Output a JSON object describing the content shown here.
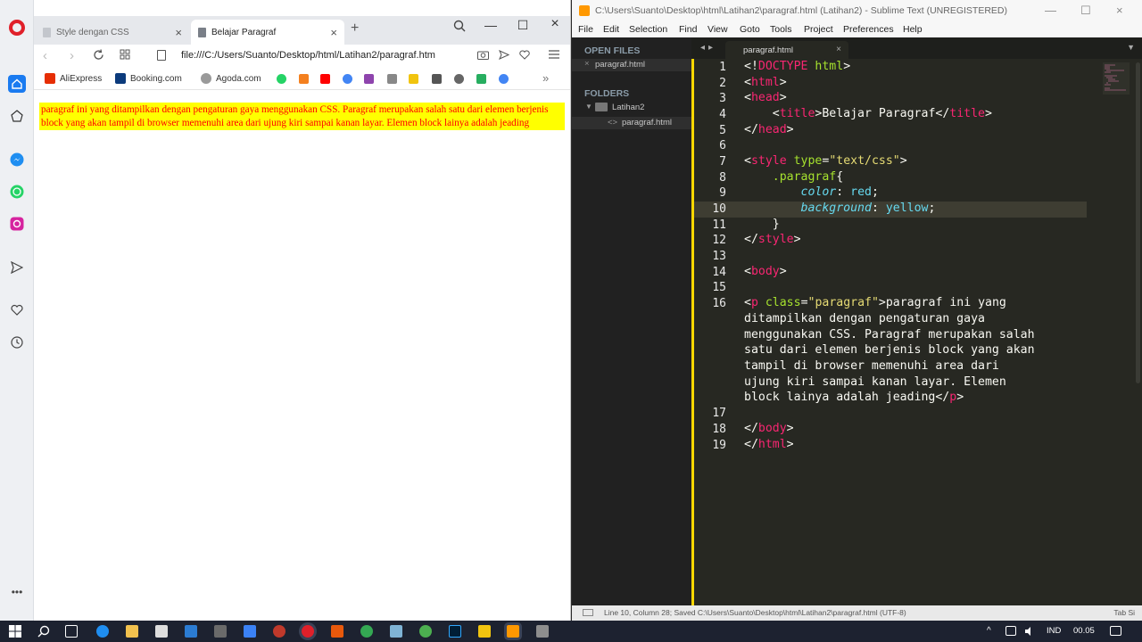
{
  "browser": {
    "tabs": [
      {
        "label": "Style dengan CSS",
        "active": false
      },
      {
        "label": "Belajar Paragraf",
        "active": true
      }
    ],
    "new_tab": "+",
    "url": "file:///C:/Users/Suanto/Desktop/html/Latihan2/paragraf.htm",
    "bookmarks": [
      {
        "label": "AliExpress",
        "color": "#e62e04"
      },
      {
        "label": "Booking.com",
        "color": "#0c3b7c"
      },
      {
        "label": "Agoda.com",
        "color": "#5b5b5b"
      }
    ],
    "page": {
      "paragraph": "paragraf ini yang ditampilkan dengan pengaturan gaya menggunakan CSS. Paragraf merupakan salah satu dari elemen berjenis block yang akan tampil di browser memenuhi area dari ujung kiri sampai kanan layar. Elemen block lainya adalah jeading",
      "paragraph_color": "#ff0000",
      "paragraph_background": "#ffff00"
    }
  },
  "editor": {
    "title": "C:\\Users\\Suanto\\Desktop\\html\\Latihan2\\paragraf.html (Latihan2) - Sublime Text (UNREGISTERED)",
    "menu": [
      "File",
      "Edit",
      "Selection",
      "Find",
      "View",
      "Goto",
      "Tools",
      "Project",
      "Preferences",
      "Help"
    ],
    "sidebar": {
      "open_files_heading": "OPEN FILES",
      "open_file": "paragraf.html",
      "folders_heading": "FOLDERS",
      "folder": "Latihan2",
      "folder_file": "paragraf.html"
    },
    "tab_label": "paragraf.html",
    "tab_close": "×",
    "line_numbers": [
      "1",
      "2",
      "3",
      "4",
      "5",
      "6",
      "7",
      "8",
      "9",
      "10",
      "11",
      "12",
      "13",
      "14",
      "15",
      "16",
      "17",
      "18",
      "19"
    ],
    "current_line": "10",
    "status": "Line 10, Column 28; Saved C:\\Users\\Suanto\\Desktop\\html\\Latihan2\\paragraf.html (UTF-8)",
    "status_right": "Tab Si"
  },
  "taskbar": {
    "language": "IND",
    "time": "00.05"
  }
}
